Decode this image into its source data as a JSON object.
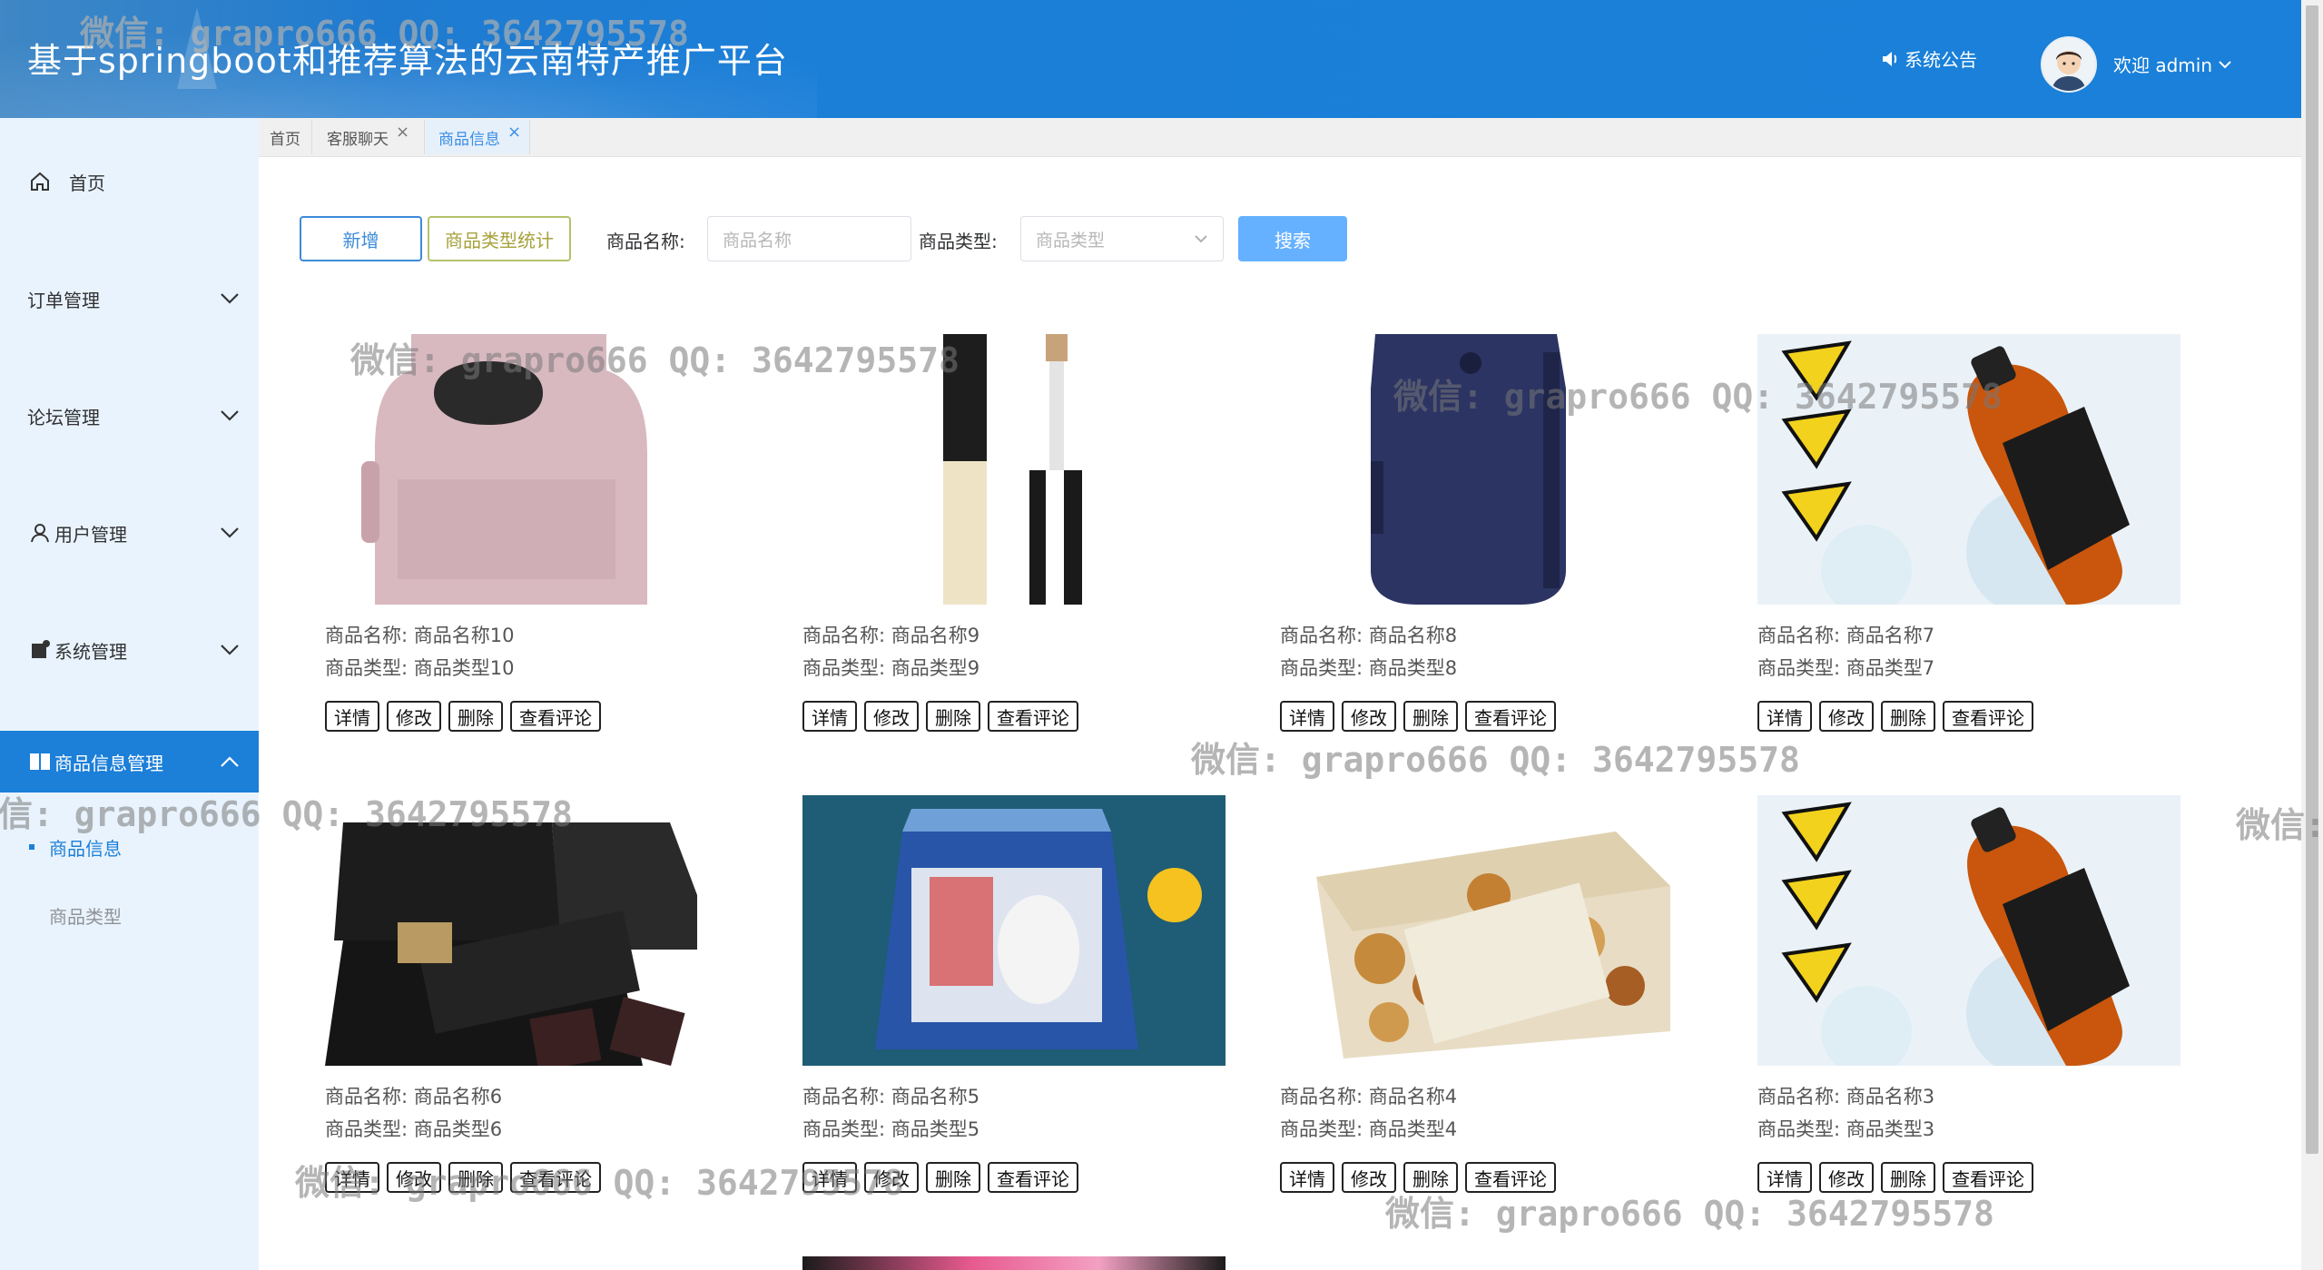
{
  "header": {
    "title": "基于springboot和推荐算法的云南特产推广平台",
    "notice": "系统公告",
    "welcome": "欢迎 admin"
  },
  "sidebar": {
    "items": [
      {
        "label": "首页",
        "icon": "home-icon"
      },
      {
        "label": "订单管理"
      },
      {
        "label": "论坛管理"
      },
      {
        "label": "用户管理",
        "icon": "user-icon"
      },
      {
        "label": "系统管理",
        "icon": "settings-icon"
      },
      {
        "label": "商品信息管理",
        "icon": "goods-icon",
        "active": true
      }
    ],
    "sub_items": [
      {
        "label": "商品信息",
        "active": true
      },
      {
        "label": "商品类型"
      }
    ]
  },
  "tabs": [
    {
      "label": "首页"
    },
    {
      "label": "客服聊天",
      "closable": true
    },
    {
      "label": "商品信息",
      "closable": true,
      "active": true
    }
  ],
  "toolbar": {
    "add_label": "新增",
    "stat_label": "商品类型统计",
    "name_label": "商品名称:",
    "name_placeholder": "商品名称",
    "type_label": "商品类型:",
    "type_placeholder": "商品类型",
    "search_label": "搜索"
  },
  "products": [
    {
      "name_label": "商品名称: 商品名称10",
      "type_label": "商品类型: 商品类型10",
      "image": "pink backpack"
    },
    {
      "name_label": "商品名称: 商品名称9",
      "type_label": "商品类型: 商品类型9",
      "image": "concealer tube"
    },
    {
      "name_label": "商品名称: 商品名称8",
      "type_label": "商品类型: 商品类型8",
      "image": "navy bag"
    },
    {
      "name_label": "商品名称: 商品名称7",
      "type_label": "商品类型: 商品类型7",
      "image": "iced tea bottle"
    },
    {
      "name_label": "商品名称: 商品名称6",
      "type_label": "商品类型: 商品类型6",
      "image": "dark chocolate box"
    },
    {
      "name_label": "商品名称: 商品名称5",
      "type_label": "商品类型: 商品类型5",
      "image": "white rabbit candy tin"
    },
    {
      "name_label": "商品名称: 商品名称4",
      "type_label": "商品类型: 商品类型4",
      "image": "chocolate box"
    },
    {
      "name_label": "商品名称: 商品名称3",
      "type_label": "商品类型: 商品类型3",
      "image": "iced tea bottle"
    }
  ],
  "card_actions": {
    "detail": "详情",
    "edit": "修改",
    "delete": "删除",
    "reviews": "查看评论"
  },
  "watermark": "微信: grapro666 QQ: 3642795578",
  "colors": {
    "header": "#1a80d9",
    "sidebar": "#e9f3fd",
    "active_menu": "#1c7fd8",
    "primary": "#3d8bd9",
    "search": "#66b1ff"
  }
}
